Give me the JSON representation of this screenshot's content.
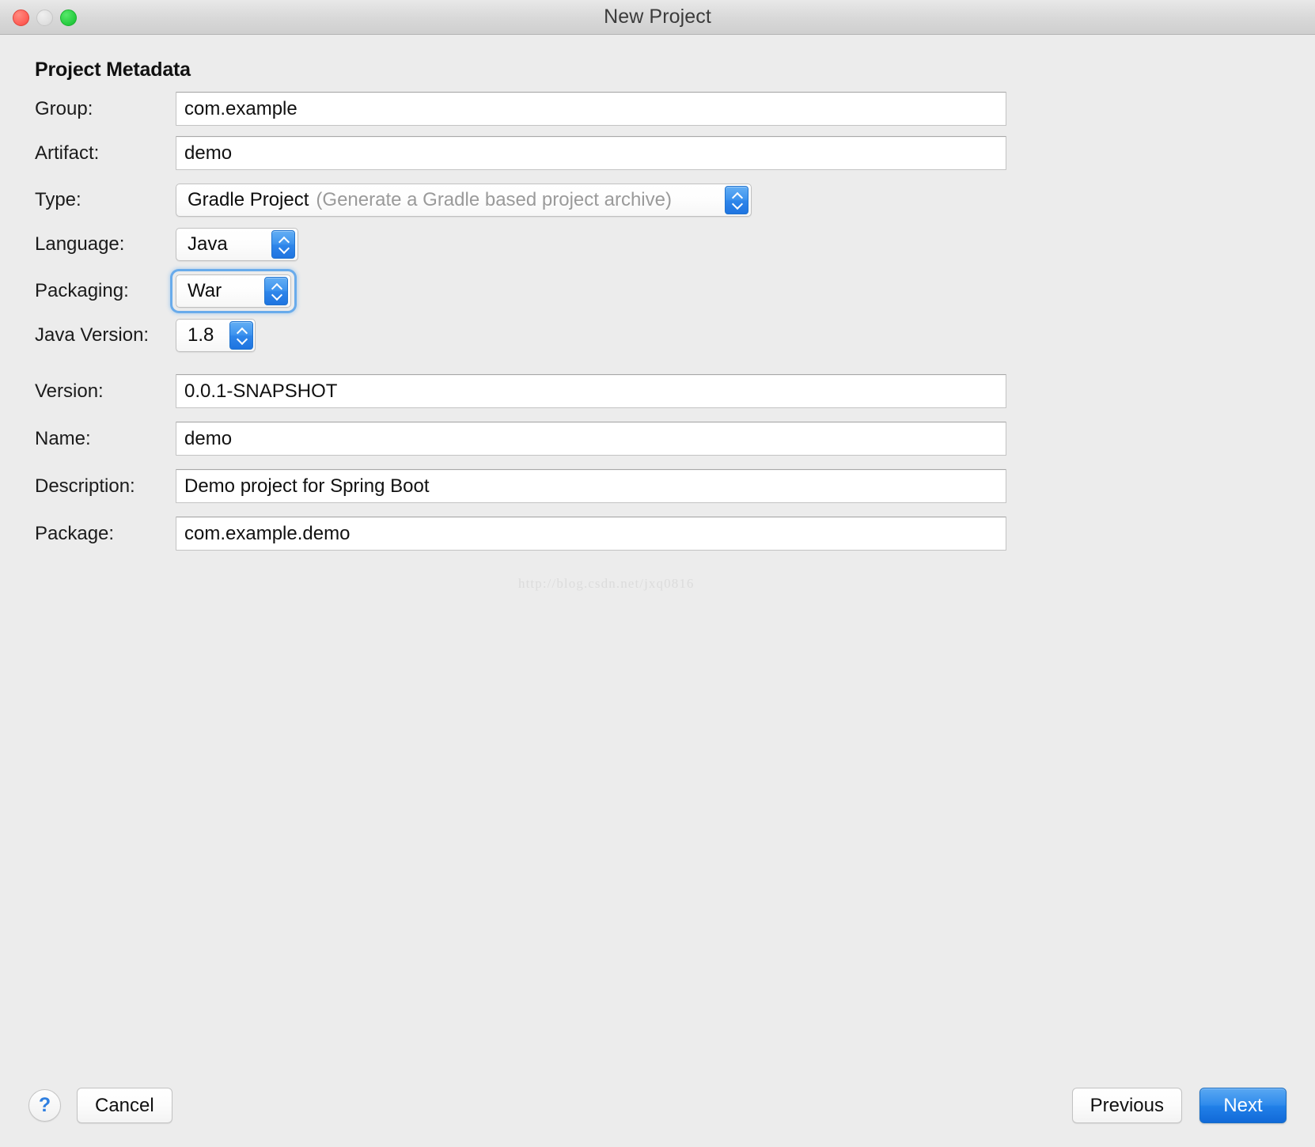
{
  "window": {
    "title": "New Project",
    "traffic_lights": [
      "close",
      "minimize",
      "maximize"
    ]
  },
  "section": {
    "heading": "Project Metadata"
  },
  "fields": {
    "group": {
      "label": "Group:",
      "value": "com.example"
    },
    "artifact": {
      "label": "Artifact:",
      "value": "demo"
    },
    "type": {
      "label": "Type:",
      "value": "Gradle Project",
      "hint": "(Generate a Gradle based project archive)"
    },
    "language": {
      "label": "Language:",
      "value": "Java"
    },
    "packaging": {
      "label": "Packaging:",
      "value": "War",
      "focused": true
    },
    "java_version": {
      "label": "Java Version:",
      "value": "1.8"
    },
    "version": {
      "label": "Version:",
      "value": "0.0.1-SNAPSHOT"
    },
    "name": {
      "label": "Name:",
      "value": "demo"
    },
    "description": {
      "label": "Description:",
      "value": "Demo project for Spring Boot"
    },
    "package": {
      "label": "Package:",
      "value": "com.example.demo"
    }
  },
  "watermark": {
    "text": "http://blog.csdn.net/jxq0816"
  },
  "footer": {
    "help_label": "?",
    "cancel_label": "Cancel",
    "previous_label": "Previous",
    "next_label": "Next"
  },
  "colors": {
    "accent": "#2f8bec",
    "window_bg": "#ececec",
    "focus_ring": "#5aa3ea",
    "hint_text": "#9a9a9a"
  }
}
